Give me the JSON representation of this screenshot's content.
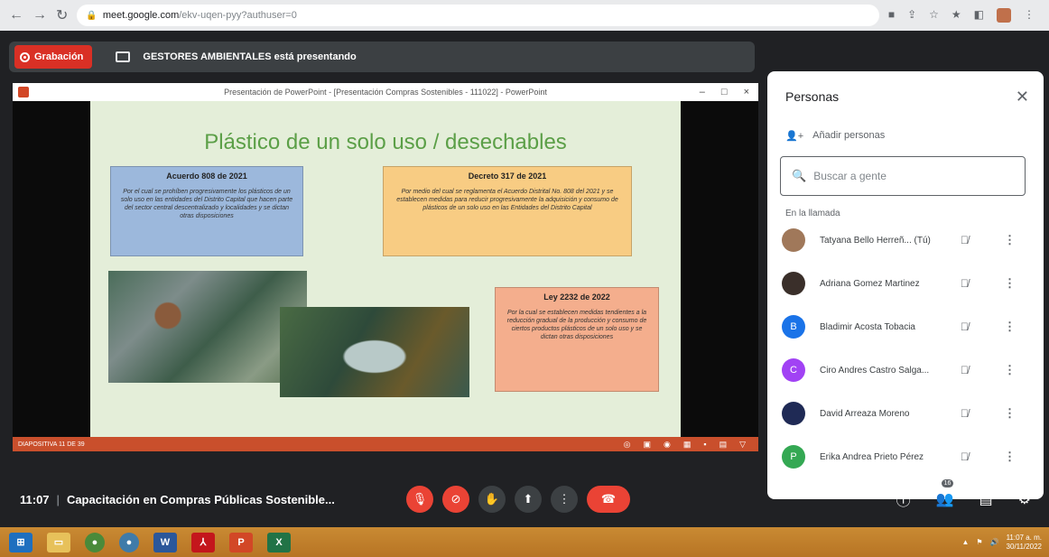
{
  "browser": {
    "url_host": "meet.google.com",
    "url_path": "/ekv-uqen-pyy?authuser=0"
  },
  "meet": {
    "recording_label": "Grabación",
    "presenting_text": "GESTORES AMBIENTALES está presentando",
    "meeting_time": "11:07",
    "meeting_title": "Capacitación en Compras Públicas Sostenible...",
    "people_badge": "16"
  },
  "powerpoint": {
    "window_title": "Presentación de PowerPoint - [Presentación Compras Sostenibles - 111022] - PowerPoint",
    "status_text": "DIAPOSITIVA 11 DE 39",
    "slide": {
      "title": "Plástico de un solo uso / desechables",
      "cards": [
        {
          "heading": "Acuerdo 808 de 2021",
          "body": "Por el cual se prohíben progresivamente los plásticos de un solo uso en las entidades del Distrito Capital que hacen parte del sector central descentralizado y localidades y se dictan otras disposiciones"
        },
        {
          "heading": "Decreto 317 de 2021",
          "body": "Por medio del cual se reglamenta el Acuerdo Distrital No. 808 del 2021 y se establecen medidas para reducir progresivamente la adquisición y consumo de plásticos de un solo uso en las Entidades del Distrito Capital"
        },
        {
          "heading": "Ley 2232 de 2022",
          "body": "Por la cual se establecen medidas tendientes a la reducción gradual de la producción y consumo de ciertos productos plásticos de un solo uso y se dictan otras disposiciones"
        }
      ]
    }
  },
  "panel": {
    "title": "Personas",
    "add_people": "Añadir personas",
    "search_placeholder": "Buscar a gente",
    "section_label": "En la llamada",
    "people": [
      {
        "name": "Tatyana Bello Herreñ...",
        "suffix": "(Tú)",
        "initial": "",
        "color": "#a0785a"
      },
      {
        "name": "Adriana Gomez Martinez",
        "suffix": "",
        "initial": "",
        "color": "#3a2f2a"
      },
      {
        "name": "Bladimir Acosta Tobacia",
        "suffix": "",
        "initial": "B",
        "color": "#1a73e8"
      },
      {
        "name": "Ciro Andres Castro Salga...",
        "suffix": "",
        "initial": "C",
        "color": "#a142f4"
      },
      {
        "name": "David Arreaza Moreno",
        "suffix": "",
        "initial": "",
        "color": "#1f2a55"
      },
      {
        "name": "Erika Andrea Prieto Pérez",
        "suffix": "",
        "initial": "P",
        "color": "#34a853"
      }
    ]
  },
  "taskbar": {
    "time": "11:07 a. m.",
    "date": "30/11/2022"
  }
}
